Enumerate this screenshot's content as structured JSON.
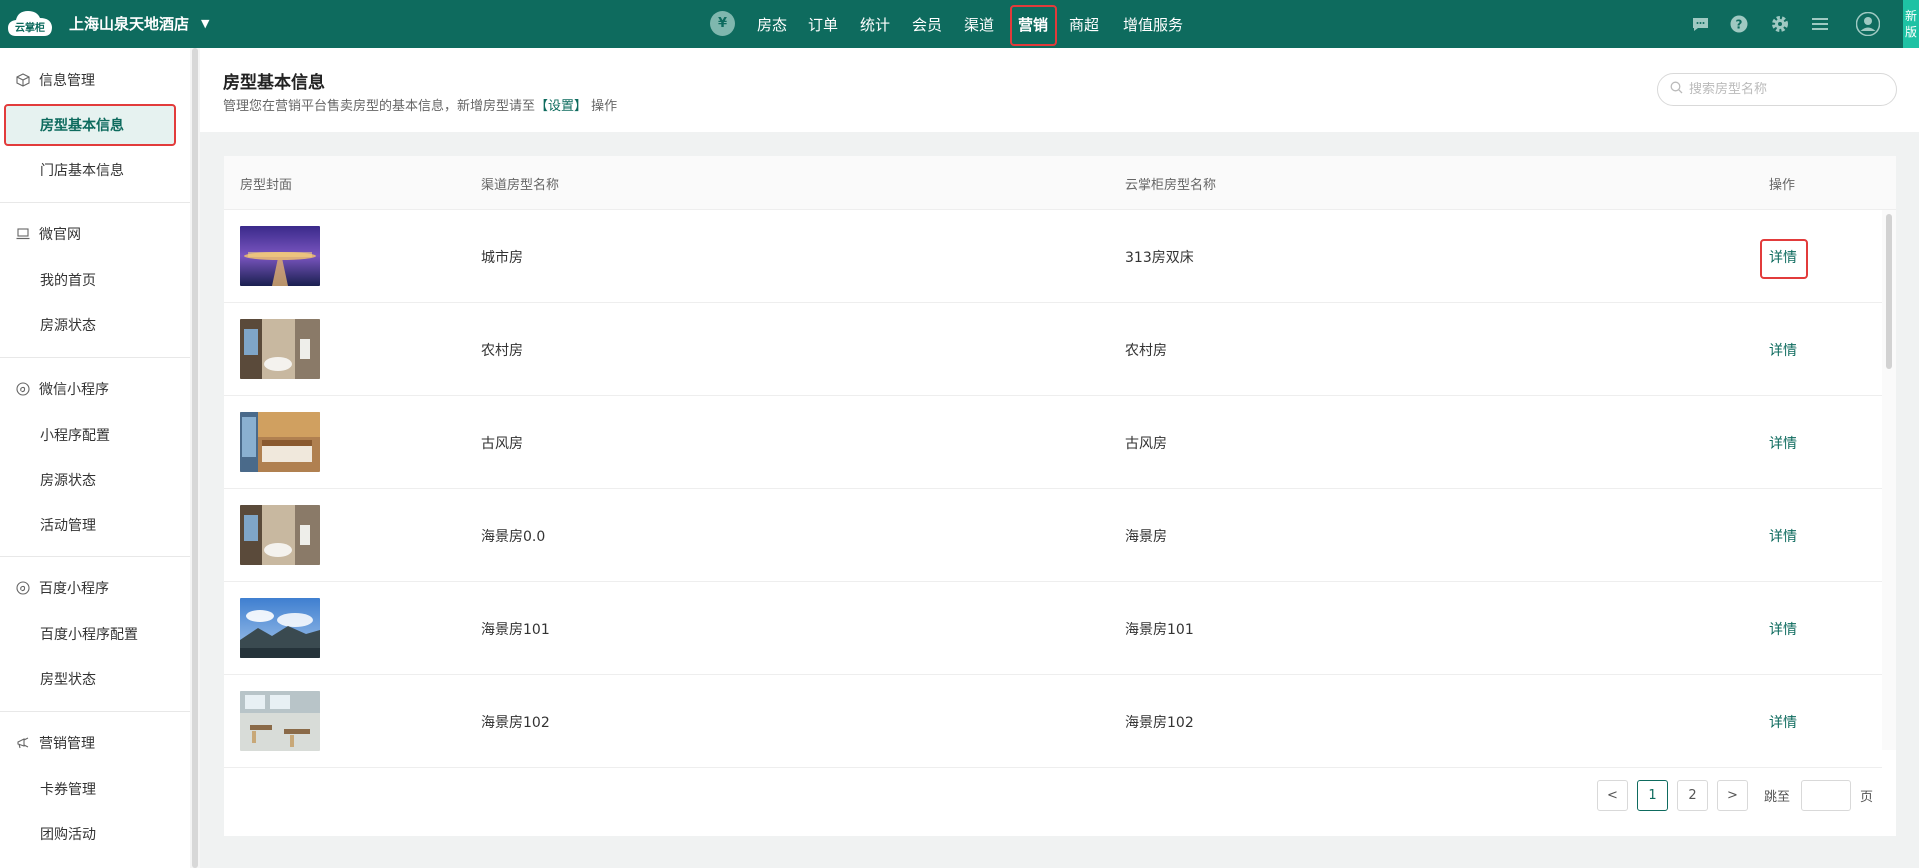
{
  "topbar": {
    "logo_text": "云掌柜",
    "hotel_name": "上海山泉天地酒店",
    "currency_symbol": "¥",
    "nav": [
      "房态",
      "订单",
      "统计",
      "会员",
      "渠道",
      "营销",
      "商超",
      "增值服务"
    ],
    "active_nav": "营销",
    "new_version_line1": "新",
    "new_version_line2": "版"
  },
  "sidebar": {
    "sections": [
      {
        "title": "信息管理",
        "icon": "cube-icon",
        "items": [
          "房型基本信息",
          "门店基本信息"
        ]
      },
      {
        "title": "微官网",
        "icon": "laptop-icon",
        "items": [
          "我的首页",
          "房源状态"
        ]
      },
      {
        "title": "微信小程序",
        "icon": "mini-program-icon",
        "items": [
          "小程序配置",
          "房源状态",
          "活动管理"
        ]
      },
      {
        "title": "百度小程序",
        "icon": "mini-program-icon",
        "items": [
          "百度小程序配置",
          "房型状态"
        ]
      },
      {
        "title": "营销管理",
        "icon": "megaphone-icon",
        "items": [
          "卡券管理",
          "团购活动"
        ]
      }
    ],
    "active_item": "房型基本信息"
  },
  "header": {
    "title": "房型基本信息",
    "desc_prefix": "管理您在营销平台售卖房型的基本信息，新增房型请至",
    "desc_link": "【设置】",
    "desc_suffix": "操作",
    "search_placeholder": "搜索房型名称"
  },
  "table": {
    "columns": [
      "房型封面",
      "渠道房型名称",
      "云掌柜房型名称",
      "操作"
    ],
    "action_label": "详情",
    "rows": [
      {
        "channel_name": "城市房",
        "ygz_name": "313房双床",
        "cover": "resort-night"
      },
      {
        "channel_name": "农村房",
        "ygz_name": "农村房",
        "cover": "bathroom"
      },
      {
        "channel_name": "古风房",
        "ygz_name": "古风房",
        "cover": "bedroom"
      },
      {
        "channel_name": "海景房0.0",
        "ygz_name": "海景房",
        "cover": "bathroom"
      },
      {
        "channel_name": "海景房101",
        "ygz_name": "海景房101",
        "cover": "mountain"
      },
      {
        "channel_name": "海景房102",
        "ygz_name": "海景房102",
        "cover": "dining"
      }
    ]
  },
  "pagination": {
    "prev": "<",
    "pages": [
      "1",
      "2"
    ],
    "current": "1",
    "next": ">",
    "jump_label": "跳至",
    "page_unit": "页"
  },
  "colors": {
    "brand": "#0e6b5e",
    "highlight": "#e23b3b",
    "new_badge": "#1ec2a4"
  }
}
